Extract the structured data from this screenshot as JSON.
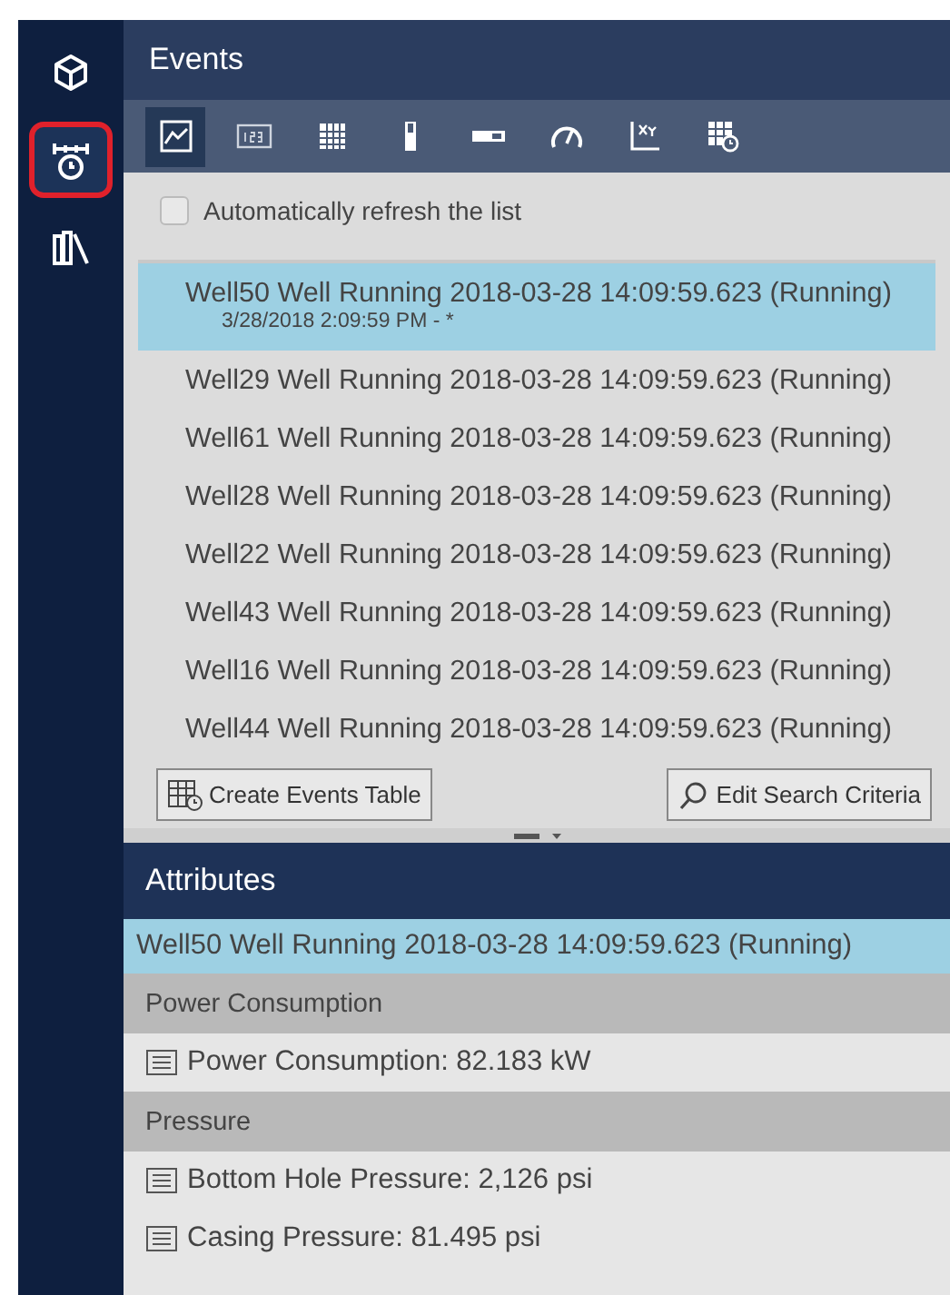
{
  "sidebar": {
    "items": [
      {
        "kind": "cube",
        "selected": false
      },
      {
        "kind": "well-clock",
        "selected": true
      },
      {
        "kind": "library",
        "selected": false
      }
    ]
  },
  "events": {
    "title": "Events",
    "toolbar": [
      {
        "kind": "trend",
        "selected": true
      },
      {
        "kind": "value",
        "selected": false
      },
      {
        "kind": "table",
        "selected": false
      },
      {
        "kind": "vbar",
        "selected": false
      },
      {
        "kind": "hbar",
        "selected": false
      },
      {
        "kind": "gauge",
        "selected": false
      },
      {
        "kind": "xy",
        "selected": false
      },
      {
        "kind": "eventtable",
        "selected": false
      }
    ],
    "auto_refresh": {
      "label": "Automatically refresh the list",
      "checked": false
    },
    "list": [
      {
        "title": "Well50 Well Running 2018-03-28 14:09:59.623 (Running)",
        "subtitle": "3/28/2018 2:09:59 PM - *",
        "selected": true
      },
      {
        "title": "Well29 Well Running 2018-03-28 14:09:59.623 (Running)",
        "selected": false
      },
      {
        "title": "Well61 Well Running 2018-03-28 14:09:59.623 (Running)",
        "selected": false
      },
      {
        "title": "Well28 Well Running 2018-03-28 14:09:59.623 (Running)",
        "selected": false
      },
      {
        "title": "Well22 Well Running 2018-03-28 14:09:59.623 (Running)",
        "selected": false
      },
      {
        "title": "Well43 Well Running 2018-03-28 14:09:59.623 (Running)",
        "selected": false
      },
      {
        "title": "Well16 Well Running 2018-03-28 14:09:59.623 (Running)",
        "selected": false
      },
      {
        "title": "Well44 Well Running 2018-03-28 14:09:59.623 (Running)",
        "selected": false
      }
    ],
    "buttons": [
      {
        "kind": "table",
        "label": "Create Events Table"
      },
      {
        "kind": "search",
        "label": "Edit Search Criteria"
      }
    ]
  },
  "attributes": {
    "title": "Attributes",
    "event": "Well50 Well Running 2018-03-28 14:09:59.623 (Running)",
    "groups": [
      {
        "name": "Power Consumption",
        "items": [
          "Power Consumption: 82.183 kW"
        ]
      },
      {
        "name": "Pressure",
        "items": [
          "Bottom Hole Pressure: 2,126 psi",
          "Casing Pressure: 81.495 psi"
        ]
      }
    ]
  }
}
